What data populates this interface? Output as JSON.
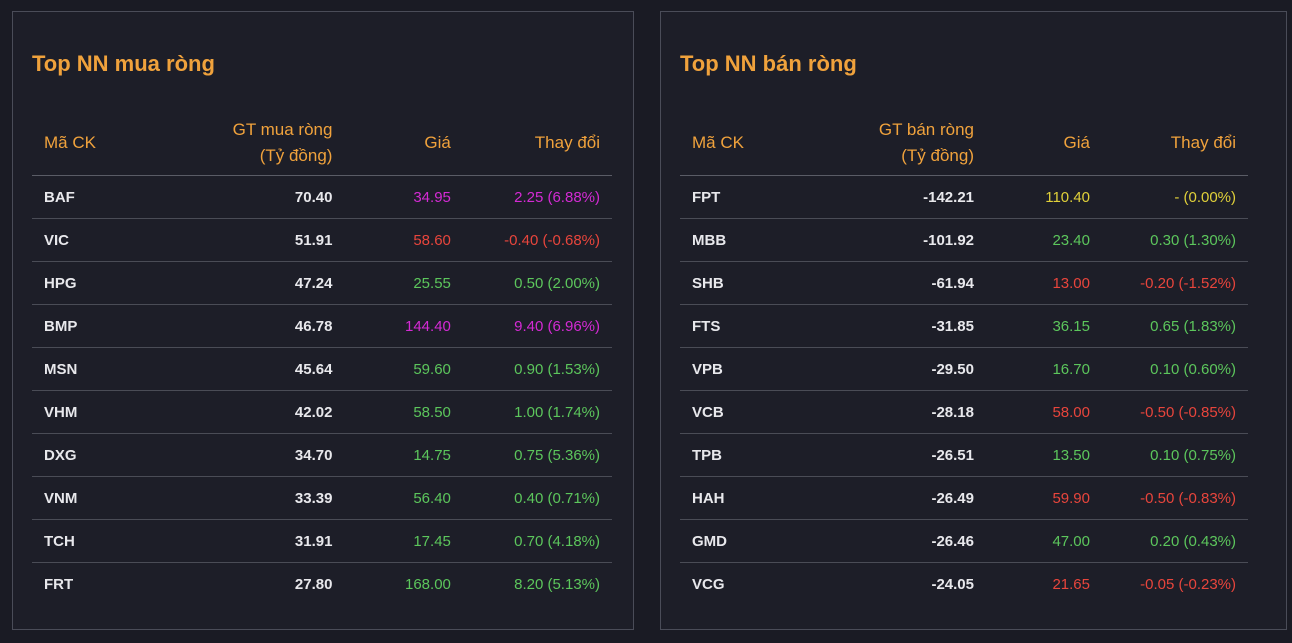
{
  "colors": {
    "up": "#5cc65c",
    "down": "#e8453c",
    "ceiling": "#d42ad4",
    "reference": "#e0d03a",
    "accent": "#f0a23c"
  },
  "buy": {
    "title": "Top NN mua ròng",
    "headers": {
      "symbol": "Mã CK",
      "value_line1": "GT mua ròng",
      "value_line2": "(Tỷ đồng)",
      "price": "Giá",
      "change": "Thay đổi"
    },
    "rows": [
      {
        "symbol": "BAF",
        "value": "70.40",
        "price": "34.95",
        "change": "2.25 (6.88%)",
        "status": "ceiling"
      },
      {
        "symbol": "VIC",
        "value": "51.91",
        "price": "58.60",
        "change": "-0.40 (-0.68%)",
        "status": "down"
      },
      {
        "symbol": "HPG",
        "value": "47.24",
        "price": "25.55",
        "change": "0.50 (2.00%)",
        "status": "up"
      },
      {
        "symbol": "BMP",
        "value": "46.78",
        "price": "144.40",
        "change": "9.40 (6.96%)",
        "status": "ceiling"
      },
      {
        "symbol": "MSN",
        "value": "45.64",
        "price": "59.60",
        "change": "0.90 (1.53%)",
        "status": "up"
      },
      {
        "symbol": "VHM",
        "value": "42.02",
        "price": "58.50",
        "change": "1.00 (1.74%)",
        "status": "up"
      },
      {
        "symbol": "DXG",
        "value": "34.70",
        "price": "14.75",
        "change": "0.75 (5.36%)",
        "status": "up"
      },
      {
        "symbol": "VNM",
        "value": "33.39",
        "price": "56.40",
        "change": "0.40 (0.71%)",
        "status": "up"
      },
      {
        "symbol": "TCH",
        "value": "31.91",
        "price": "17.45",
        "change": "0.70 (4.18%)",
        "status": "up"
      },
      {
        "symbol": "FRT",
        "value": "27.80",
        "price": "168.00",
        "change": "8.20 (5.13%)",
        "status": "up"
      }
    ]
  },
  "sell": {
    "title": "Top NN bán ròng",
    "headers": {
      "symbol": "Mã CK",
      "value_line1": "GT bán ròng",
      "value_line2": "(Tỷ đồng)",
      "price": "Giá",
      "change": "Thay đổi"
    },
    "rows": [
      {
        "symbol": "FPT",
        "value": "-142.21",
        "price": "110.40",
        "change": "- (0.00%)",
        "status": "reference"
      },
      {
        "symbol": "MBB",
        "value": "-101.92",
        "price": "23.40",
        "change": "0.30 (1.30%)",
        "status": "up"
      },
      {
        "symbol": "SHB",
        "value": "-61.94",
        "price": "13.00",
        "change": "-0.20 (-1.52%)",
        "status": "down"
      },
      {
        "symbol": "FTS",
        "value": "-31.85",
        "price": "36.15",
        "change": "0.65 (1.83%)",
        "status": "up"
      },
      {
        "symbol": "VPB",
        "value": "-29.50",
        "price": "16.70",
        "change": "0.10 (0.60%)",
        "status": "up"
      },
      {
        "symbol": "VCB",
        "value": "-28.18",
        "price": "58.00",
        "change": "-0.50 (-0.85%)",
        "status": "down"
      },
      {
        "symbol": "TPB",
        "value": "-26.51",
        "price": "13.50",
        "change": "0.10 (0.75%)",
        "status": "up"
      },
      {
        "symbol": "HAH",
        "value": "-26.49",
        "price": "59.90",
        "change": "-0.50 (-0.83%)",
        "status": "down"
      },
      {
        "symbol": "GMD",
        "value": "-26.46",
        "price": "47.00",
        "change": "0.20 (0.43%)",
        "status": "up"
      },
      {
        "symbol": "VCG",
        "value": "-24.05",
        "price": "21.65",
        "change": "-0.05 (-0.23%)",
        "status": "down"
      }
    ]
  }
}
